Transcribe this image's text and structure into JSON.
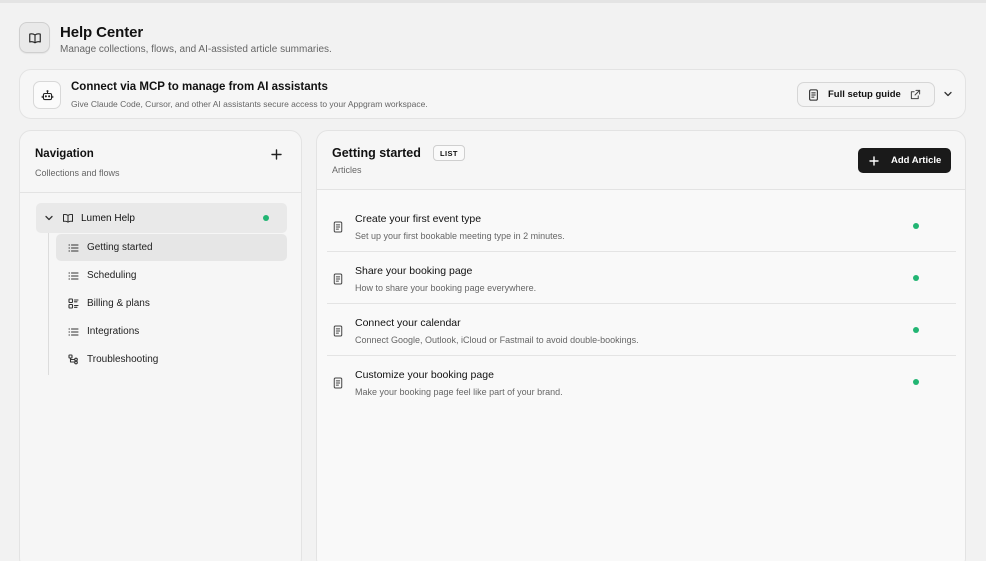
{
  "header": {
    "title": "Help Center",
    "subtitle": "Manage collections, flows, and AI-assisted article summaries.",
    "icon": "book-open-icon"
  },
  "mcp": {
    "title": "Connect via MCP to manage from AI assistants",
    "subtitle": "Give Claude Code, Cursor, and other AI assistants secure access to your Appgram workspace.",
    "guide_label": "Full setup guide",
    "icon": "bot-icon"
  },
  "nav": {
    "title": "Navigation",
    "subtitle": "Collections and flows",
    "root": {
      "label": "Lumen Help",
      "status": "published"
    },
    "items": [
      {
        "label": "Getting started",
        "icon": "list-icon",
        "active": true
      },
      {
        "label": "Scheduling",
        "icon": "list-icon",
        "active": false
      },
      {
        "label": "Billing & plans",
        "icon": "grid-list-icon",
        "active": false
      },
      {
        "label": "Integrations",
        "icon": "list-icon",
        "active": false
      },
      {
        "label": "Troubleshooting",
        "icon": "flow-icon",
        "active": false
      }
    ]
  },
  "main": {
    "title": "Getting started",
    "badge": "LIST",
    "subtitle": "Articles",
    "add_label": "Add Article",
    "articles": [
      {
        "title": "Create your first event type",
        "summary": "Set up your first bookable meeting type in 2 minutes."
      },
      {
        "title": "Share your booking page",
        "summary": "How to share your booking page everywhere."
      },
      {
        "title": "Connect your calendar",
        "summary": "Connect Google, Outlook, iCloud or Fastmail to avoid double-bookings."
      },
      {
        "title": "Customize your booking page",
        "summary": "Make your booking page feel like part of your brand."
      }
    ]
  },
  "colors": {
    "status_dot": "#22b573",
    "primary_button": "#1a1a1a",
    "background": "#f2f2f2"
  }
}
